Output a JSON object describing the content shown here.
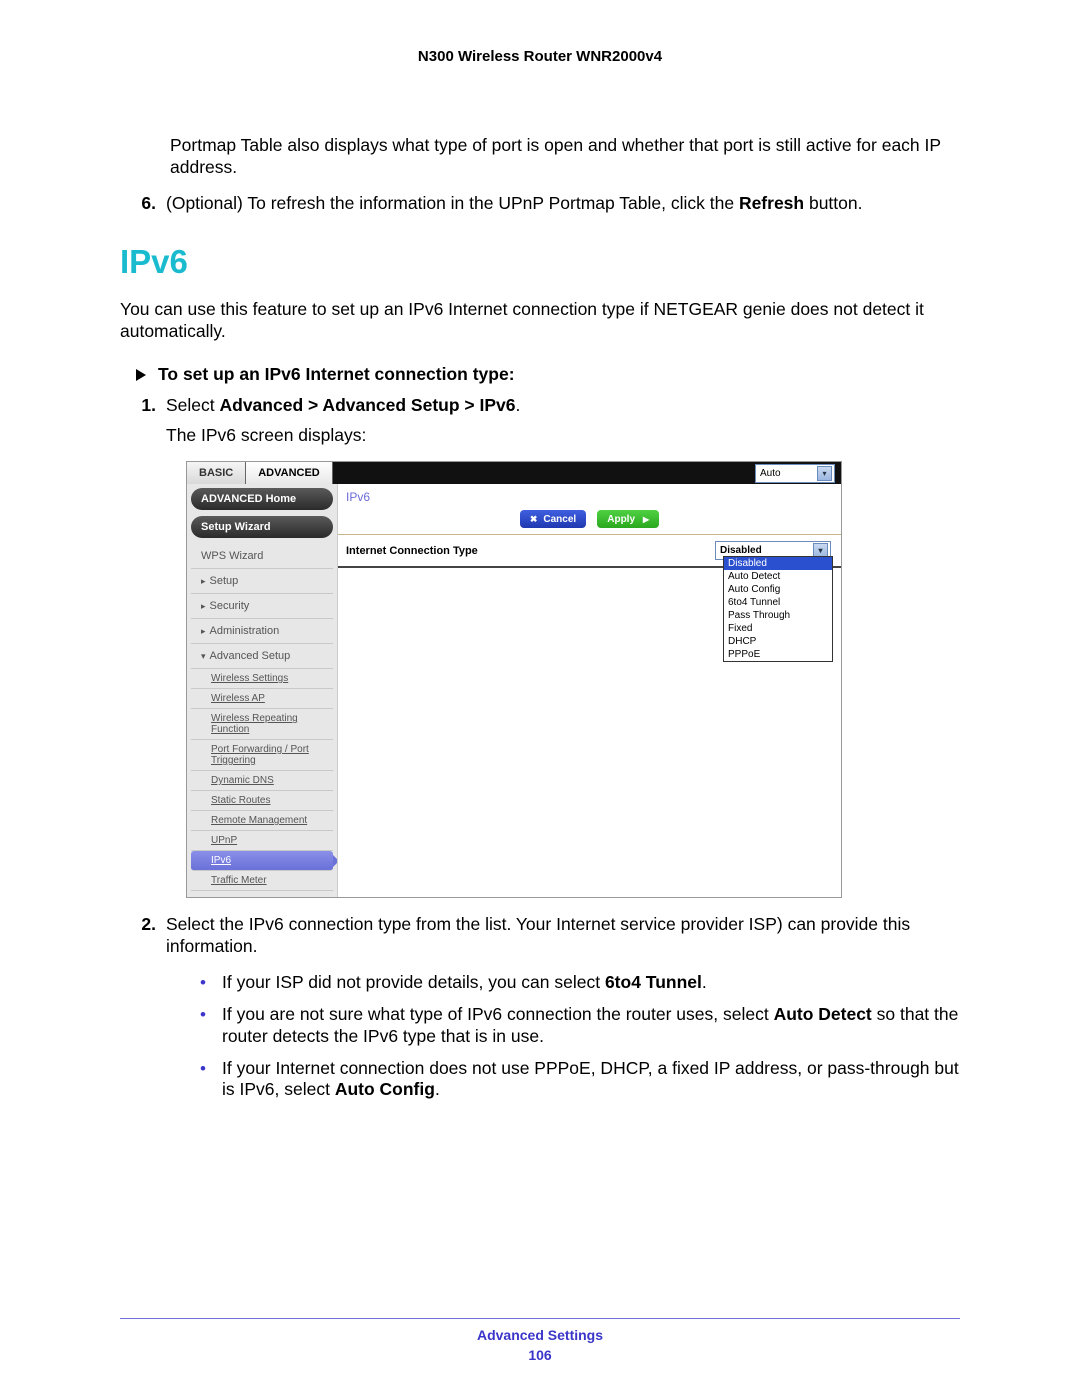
{
  "doc_title": "N300 Wireless Router WNR2000v4",
  "intro_portmap": "Portmap Table also displays what type of port is open and whether that port is still active for each IP address.",
  "step6": {
    "num": "6.",
    "prefix": "(Optional) To refresh the information in the UPnP Portmap Table, click the ",
    "bold": "Refresh",
    "suffix": " button."
  },
  "section_heading": "IPv6",
  "ipv6_intro": "You can use this feature to set up an IPv6 Internet connection type if NETGEAR genie does not detect it automatically.",
  "subhead": "To set up an IPv6 Internet connection type:",
  "step1": {
    "num": "1.",
    "prefix": "Select ",
    "bold": "Advanced > Advanced Setup > IPv6",
    "suffix": "."
  },
  "step1_followup": "The IPv6 screen displays:",
  "screenshot": {
    "tab_basic": "BASIC",
    "tab_advanced": "ADVANCED",
    "top_select_value": "Auto",
    "side_home": "ADVANCED Home",
    "side_setup_wizard": "Setup Wizard",
    "wps_wizard": "WPS Wizard",
    "setup": "Setup",
    "security": "Security",
    "administration": "Administration",
    "advanced_setup": "Advanced Setup",
    "sub_items": [
      "Wireless Settings",
      "Wireless AP",
      "Wireless Repeating Function",
      "Port Forwarding / Port Triggering",
      "Dynamic DNS",
      "Static Routes",
      "Remote Management",
      "UPnP",
      "IPv6",
      "Traffic Meter"
    ],
    "main_title": "IPv6",
    "cancel": "Cancel",
    "apply": "Apply",
    "conn_label": "Internet Connection Type",
    "conn_selected": "Disabled",
    "dropdown_options": [
      "Disabled",
      "Auto Detect",
      "Auto Config",
      "6to4 Tunnel",
      "Pass Through",
      "Fixed",
      "DHCP",
      "PPPoE"
    ]
  },
  "step2": {
    "num": "2.",
    "text": "Select the IPv6 connection type from the list. Your Internet service provider ISP) can provide this information."
  },
  "bullets": [
    {
      "prefix": "If your ISP did not provide details, you can select ",
      "bold": "6to4 Tunnel",
      "suffix": "."
    },
    {
      "prefix": "If you are not sure what type of IPv6 connection the router uses, select ",
      "bold": "Auto Detect",
      "suffix": " so that the router detects the IPv6 type that is in use."
    },
    {
      "prefix": "If your Internet connection does not use PPPoE, DHCP, a fixed IP address, or pass-through but is IPv6, select ",
      "bold": "Auto Config",
      "suffix": "."
    }
  ],
  "footer_section": "Advanced Settings",
  "footer_page": "106"
}
